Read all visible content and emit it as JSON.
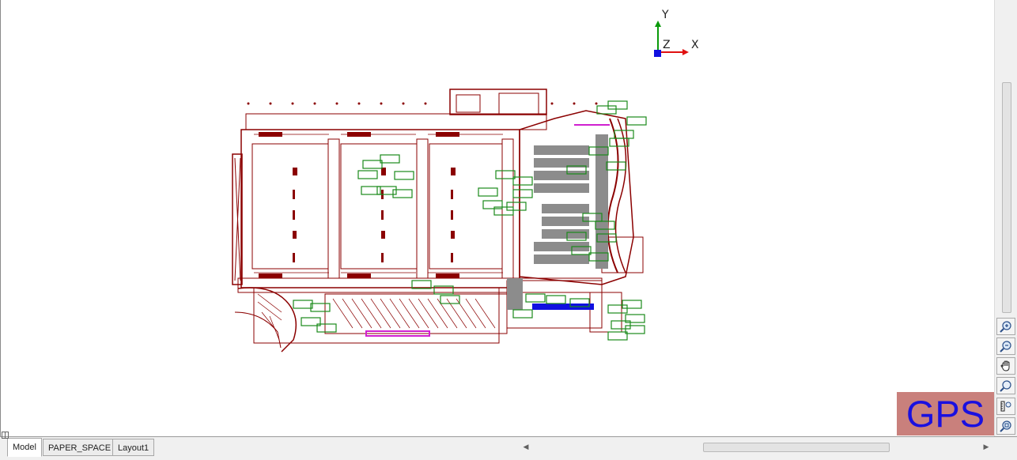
{
  "ucs": {
    "y_label": "Y",
    "z_label": "Z",
    "x_label": "X"
  },
  "tabs": [
    {
      "label": "Model",
      "active": true
    },
    {
      "label": "PAPER_SPACE",
      "active": false
    },
    {
      "label": "Layout1",
      "active": false
    }
  ],
  "nav_tools": [
    {
      "name": "zoom-in-icon"
    },
    {
      "name": "zoom-out-icon"
    },
    {
      "name": "pan-hand-icon"
    },
    {
      "name": "zoom-realtime-icon"
    },
    {
      "name": "zoom-window-icon"
    },
    {
      "name": "zoom-extents-icon"
    }
  ],
  "watermark": {
    "text": "GPS"
  },
  "colors": {
    "drawing": "#8b0000",
    "annotation": "#1a8a1a",
    "furniture": "#8c8c8c",
    "accent_magenta": "#d020d0",
    "accent_blue": "#1010e0",
    "watermark_bg": "#c9807c",
    "watermark_text": "#1a10e0"
  }
}
